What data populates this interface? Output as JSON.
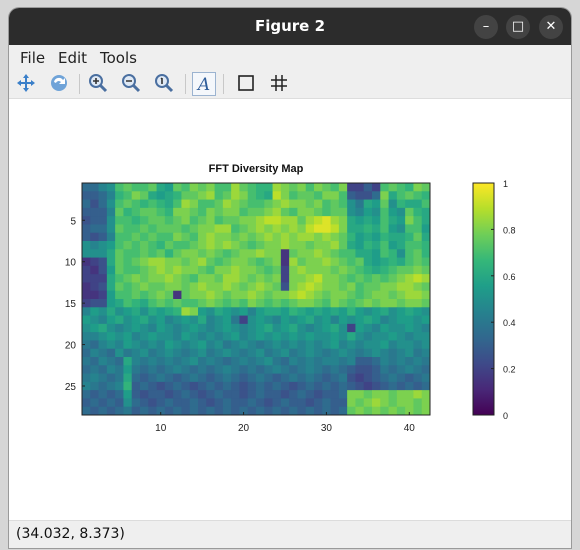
{
  "window": {
    "title": "Figure 2",
    "controls": [
      "minimize-icon",
      "maximize-icon",
      "close-icon"
    ]
  },
  "menu": {
    "items": [
      "File",
      "Edit",
      "Tools"
    ]
  },
  "toolbar": {
    "tools": [
      "pan-icon",
      "rotate-icon",
      "zoom-in-icon",
      "zoom-out-icon",
      "zoom-reset-icon",
      "text-annotation-icon",
      "axes-box-icon",
      "grid-icon"
    ],
    "text_glyph": "A"
  },
  "status": {
    "coords": "(34.032, 8.373)"
  },
  "colors": {
    "colormap": [
      "#440154",
      "#482878",
      "#3e4a89",
      "#31688e",
      "#26828e",
      "#1f9e89",
      "#35b779",
      "#6ece58",
      "#b5de2b",
      "#fde725"
    ]
  },
  "chart_data": {
    "type": "heatmap",
    "title": "FFT Diversity Map",
    "xlim": [
      0.5,
      42.5
    ],
    "ylim": [
      0.5,
      28.5
    ],
    "y_reversed": true,
    "x_ticks": [
      10,
      20,
      30,
      40
    ],
    "y_ticks": [
      5,
      10,
      15,
      20,
      25
    ],
    "colorbar": {
      "limits": [
        0,
        1
      ],
      "ticks": [
        "0",
        "0.2",
        "0.4",
        "0.6",
        "0.8",
        "1"
      ]
    },
    "colormap": "viridis",
    "n_cols": 42,
    "n_rows": 28,
    "values": [
      [
        0.35,
        0.35,
        0.45,
        0.5,
        0.7,
        0.75,
        0.7,
        0.7,
        0.75,
        0.6,
        0.55,
        0.75,
        0.7,
        0.8,
        0.75,
        0.8,
        0.7,
        0.7,
        0.85,
        0.75,
        0.7,
        0.65,
        0.65,
        0.85,
        0.8,
        0.75,
        0.8,
        0.7,
        0.8,
        0.75,
        0.7,
        0.8,
        0.2,
        0.2,
        0.3,
        0.2,
        0.7,
        0.75,
        0.7,
        0.65,
        0.8,
        0.75
      ],
      [
        0.3,
        0.3,
        0.35,
        0.45,
        0.65,
        0.7,
        0.8,
        0.75,
        0.6,
        0.55,
        0.6,
        0.65,
        0.75,
        0.75,
        0.8,
        0.85,
        0.7,
        0.75,
        0.85,
        0.8,
        0.7,
        0.65,
        0.6,
        0.9,
        0.8,
        0.7,
        0.75,
        0.75,
        0.7,
        0.8,
        0.8,
        0.7,
        0.3,
        0.25,
        0.25,
        0.35,
        0.8,
        0.6,
        0.7,
        0.75,
        0.7,
        0.65
      ],
      [
        0.35,
        0.25,
        0.35,
        0.5,
        0.7,
        0.75,
        0.7,
        0.65,
        0.7,
        0.65,
        0.6,
        0.7,
        0.85,
        0.8,
        0.7,
        0.7,
        0.75,
        0.85,
        0.8,
        0.75,
        0.7,
        0.7,
        0.75,
        0.8,
        0.85,
        0.8,
        0.8,
        0.75,
        0.8,
        0.7,
        0.75,
        0.7,
        0.5,
        0.4,
        0.6,
        0.55,
        0.75,
        0.5,
        0.65,
        0.6,
        0.6,
        0.7
      ],
      [
        0.3,
        0.3,
        0.3,
        0.45,
        0.75,
        0.65,
        0.7,
        0.75,
        0.75,
        0.7,
        0.65,
        0.8,
        0.8,
        0.75,
        0.7,
        0.8,
        0.75,
        0.8,
        0.8,
        0.7,
        0.75,
        0.75,
        0.8,
        0.85,
        0.75,
        0.7,
        0.8,
        0.8,
        0.75,
        0.7,
        0.75,
        0.75,
        0.5,
        0.45,
        0.55,
        0.5,
        0.7,
        0.55,
        0.5,
        0.75,
        0.65,
        0.6
      ],
      [
        0.25,
        0.3,
        0.3,
        0.5,
        0.7,
        0.7,
        0.65,
        0.7,
        0.75,
        0.75,
        0.7,
        0.75,
        0.8,
        0.7,
        0.75,
        0.8,
        0.7,
        0.75,
        0.75,
        0.8,
        0.8,
        0.85,
        0.9,
        0.9,
        0.85,
        0.85,
        0.75,
        0.85,
        0.9,
        0.95,
        0.85,
        0.8,
        0.6,
        0.55,
        0.6,
        0.55,
        0.7,
        0.6,
        0.55,
        0.8,
        0.7,
        0.6
      ],
      [
        0.3,
        0.35,
        0.35,
        0.5,
        0.75,
        0.7,
        0.7,
        0.75,
        0.7,
        0.75,
        0.75,
        0.75,
        0.7,
        0.75,
        0.8,
        0.8,
        0.85,
        0.85,
        0.7,
        0.75,
        0.8,
        0.85,
        0.8,
        0.85,
        0.8,
        0.85,
        0.8,
        0.9,
        0.95,
        0.95,
        0.9,
        0.8,
        0.6,
        0.6,
        0.65,
        0.6,
        0.7,
        0.55,
        0.5,
        0.7,
        0.7,
        0.55
      ],
      [
        0.3,
        0.25,
        0.3,
        0.45,
        0.7,
        0.7,
        0.75,
        0.7,
        0.75,
        0.7,
        0.7,
        0.8,
        0.75,
        0.7,
        0.8,
        0.85,
        0.8,
        0.8,
        0.75,
        0.8,
        0.75,
        0.8,
        0.85,
        0.8,
        0.85,
        0.8,
        0.85,
        0.85,
        0.8,
        0.85,
        0.8,
        0.75,
        0.65,
        0.55,
        0.6,
        0.55,
        0.65,
        0.6,
        0.6,
        0.65,
        0.75,
        0.6
      ],
      [
        0.5,
        0.45,
        0.5,
        0.55,
        0.7,
        0.75,
        0.7,
        0.75,
        0.7,
        0.65,
        0.75,
        0.7,
        0.7,
        0.75,
        0.8,
        0.85,
        0.8,
        0.85,
        0.8,
        0.75,
        0.7,
        0.75,
        0.8,
        0.8,
        0.85,
        0.8,
        0.8,
        0.75,
        0.8,
        0.8,
        0.85,
        0.75,
        0.6,
        0.55,
        0.65,
        0.6,
        0.7,
        0.55,
        0.6,
        0.7,
        0.7,
        0.65
      ],
      [
        0.5,
        0.5,
        0.5,
        0.6,
        0.75,
        0.7,
        0.7,
        0.75,
        0.7,
        0.75,
        0.65,
        0.75,
        0.8,
        0.8,
        0.75,
        0.8,
        0.75,
        0.7,
        0.75,
        0.8,
        0.8,
        0.85,
        0.8,
        0.8,
        0.15,
        0.75,
        0.8,
        0.8,
        0.85,
        0.8,
        0.75,
        0.7,
        0.7,
        0.6,
        0.6,
        0.55,
        0.7,
        0.65,
        0.5,
        0.7,
        0.75,
        0.65
      ],
      [
        0.15,
        0.2,
        0.25,
        0.6,
        0.75,
        0.7,
        0.75,
        0.8,
        0.85,
        0.85,
        0.8,
        0.8,
        0.75,
        0.8,
        0.85,
        0.75,
        0.7,
        0.75,
        0.8,
        0.8,
        0.75,
        0.7,
        0.75,
        0.8,
        0.15,
        0.85,
        0.75,
        0.8,
        0.8,
        0.85,
        0.8,
        0.75,
        0.7,
        0.75,
        0.6,
        0.55,
        0.6,
        0.65,
        0.6,
        0.7,
        0.75,
        0.7
      ],
      [
        0.2,
        0.15,
        0.25,
        0.55,
        0.75,
        0.7,
        0.7,
        0.75,
        0.8,
        0.85,
        0.8,
        0.85,
        0.8,
        0.8,
        0.75,
        0.7,
        0.8,
        0.8,
        0.85,
        0.8,
        0.8,
        0.75,
        0.7,
        0.75,
        0.2,
        0.8,
        0.85,
        0.8,
        0.8,
        0.8,
        0.75,
        0.8,
        0.75,
        0.7,
        0.65,
        0.6,
        0.65,
        0.7,
        0.75,
        0.75,
        0.8,
        0.75
      ],
      [
        0.2,
        0.2,
        0.2,
        0.6,
        0.7,
        0.75,
        0.8,
        0.75,
        0.8,
        0.8,
        0.85,
        0.8,
        0.75,
        0.7,
        0.8,
        0.8,
        0.75,
        0.85,
        0.85,
        0.8,
        0.75,
        0.8,
        0.75,
        0.8,
        0.2,
        0.8,
        0.8,
        0.85,
        0.9,
        0.8,
        0.8,
        0.75,
        0.7,
        0.75,
        0.7,
        0.75,
        0.7,
        0.75,
        0.8,
        0.85,
        0.9,
        0.85
      ],
      [
        0.15,
        0.2,
        0.25,
        0.6,
        0.75,
        0.7,
        0.75,
        0.8,
        0.75,
        0.75,
        0.8,
        0.8,
        0.75,
        0.8,
        0.85,
        0.8,
        0.8,
        0.85,
        0.8,
        0.75,
        0.8,
        0.85,
        0.8,
        0.75,
        0.25,
        0.8,
        0.85,
        0.9,
        0.85,
        0.8,
        0.8,
        0.75,
        0.8,
        0.7,
        0.75,
        0.75,
        0.8,
        0.8,
        0.85,
        0.85,
        0.8,
        0.75
      ],
      [
        0.15,
        0.15,
        0.2,
        0.55,
        0.7,
        0.7,
        0.75,
        0.7,
        0.75,
        0.8,
        0.75,
        0.15,
        0.75,
        0.8,
        0.8,
        0.85,
        0.8,
        0.75,
        0.8,
        0.8,
        0.85,
        0.8,
        0.75,
        0.8,
        0.8,
        0.85,
        0.9,
        0.85,
        0.8,
        0.75,
        0.8,
        0.8,
        0.75,
        0.7,
        0.75,
        0.8,
        0.8,
        0.75,
        0.8,
        0.85,
        0.85,
        0.8
      ],
      [
        0.2,
        0.25,
        0.25,
        0.55,
        0.6,
        0.7,
        0.65,
        0.6,
        0.7,
        0.75,
        0.7,
        0.75,
        0.7,
        0.7,
        0.75,
        0.8,
        0.75,
        0.7,
        0.75,
        0.7,
        0.8,
        0.75,
        0.7,
        0.75,
        0.7,
        0.75,
        0.8,
        0.8,
        0.75,
        0.7,
        0.8,
        0.75,
        0.7,
        0.75,
        0.8,
        0.75,
        0.8,
        0.8,
        0.75,
        0.8,
        0.8,
        0.75
      ],
      [
        0.45,
        0.55,
        0.5,
        0.6,
        0.5,
        0.55,
        0.6,
        0.5,
        0.6,
        0.55,
        0.6,
        0.65,
        0.85,
        0.8,
        0.55,
        0.5,
        0.6,
        0.55,
        0.5,
        0.55,
        0.45,
        0.55,
        0.6,
        0.6,
        0.55,
        0.65,
        0.6,
        0.55,
        0.6,
        0.55,
        0.6,
        0.55,
        0.65,
        0.55,
        0.5,
        0.55,
        0.6,
        0.5,
        0.55,
        0.6,
        0.55,
        0.5
      ],
      [
        0.55,
        0.5,
        0.45,
        0.55,
        0.6,
        0.5,
        0.55,
        0.6,
        0.5,
        0.55,
        0.45,
        0.5,
        0.55,
        0.5,
        0.6,
        0.45,
        0.5,
        0.55,
        0.4,
        0.2,
        0.5,
        0.55,
        0.5,
        0.45,
        0.55,
        0.5,
        0.55,
        0.6,
        0.5,
        0.55,
        0.45,
        0.55,
        0.5,
        0.55,
        0.6,
        0.55,
        0.45,
        0.5,
        0.55,
        0.55,
        0.5,
        0.55
      ],
      [
        0.5,
        0.55,
        0.6,
        0.5,
        0.45,
        0.5,
        0.55,
        0.5,
        0.45,
        0.55,
        0.5,
        0.45,
        0.5,
        0.55,
        0.5,
        0.45,
        0.5,
        0.55,
        0.5,
        0.45,
        0.5,
        0.55,
        0.6,
        0.5,
        0.55,
        0.6,
        0.5,
        0.45,
        0.5,
        0.55,
        0.6,
        0.5,
        0.2,
        0.55,
        0.5,
        0.45,
        0.55,
        0.5,
        0.5,
        0.55,
        0.5,
        0.45
      ],
      [
        0.45,
        0.45,
        0.5,
        0.55,
        0.5,
        0.55,
        0.45,
        0.5,
        0.55,
        0.5,
        0.5,
        0.45,
        0.55,
        0.5,
        0.45,
        0.5,
        0.45,
        0.5,
        0.55,
        0.45,
        0.5,
        0.55,
        0.5,
        0.55,
        0.5,
        0.55,
        0.5,
        0.55,
        0.5,
        0.5,
        0.55,
        0.5,
        0.6,
        0.5,
        0.45,
        0.5,
        0.5,
        0.55,
        0.5,
        0.45,
        0.5,
        0.5
      ],
      [
        0.4,
        0.35,
        0.45,
        0.5,
        0.45,
        0.55,
        0.5,
        0.45,
        0.5,
        0.45,
        0.55,
        0.5,
        0.45,
        0.5,
        0.55,
        0.45,
        0.5,
        0.4,
        0.45,
        0.5,
        0.45,
        0.4,
        0.45,
        0.5,
        0.45,
        0.5,
        0.45,
        0.5,
        0.45,
        0.5,
        0.55,
        0.45,
        0.5,
        0.45,
        0.5,
        0.5,
        0.55,
        0.45,
        0.5,
        0.5,
        0.45,
        0.5
      ],
      [
        0.35,
        0.45,
        0.4,
        0.35,
        0.5,
        0.4,
        0.45,
        0.5,
        0.4,
        0.45,
        0.5,
        0.45,
        0.4,
        0.45,
        0.5,
        0.4,
        0.45,
        0.5,
        0.45,
        0.4,
        0.45,
        0.5,
        0.4,
        0.45,
        0.5,
        0.4,
        0.45,
        0.5,
        0.45,
        0.4,
        0.45,
        0.5,
        0.45,
        0.4,
        0.45,
        0.5,
        0.45,
        0.4,
        0.45,
        0.5,
        0.4,
        0.45
      ],
      [
        0.4,
        0.35,
        0.45,
        0.4,
        0.35,
        0.6,
        0.45,
        0.4,
        0.45,
        0.4,
        0.45,
        0.4,
        0.45,
        0.5,
        0.4,
        0.45,
        0.4,
        0.35,
        0.4,
        0.45,
        0.4,
        0.45,
        0.5,
        0.4,
        0.35,
        0.45,
        0.4,
        0.45,
        0.4,
        0.45,
        0.45,
        0.4,
        0.45,
        0.3,
        0.3,
        0.35,
        0.45,
        0.4,
        0.45,
        0.4,
        0.45,
        0.4
      ],
      [
        0.35,
        0.4,
        0.35,
        0.45,
        0.4,
        0.55,
        0.4,
        0.35,
        0.4,
        0.35,
        0.4,
        0.45,
        0.4,
        0.35,
        0.4,
        0.35,
        0.4,
        0.45,
        0.4,
        0.35,
        0.4,
        0.35,
        0.4,
        0.45,
        0.4,
        0.35,
        0.4,
        0.45,
        0.4,
        0.35,
        0.4,
        0.35,
        0.3,
        0.25,
        0.25,
        0.3,
        0.4,
        0.35,
        0.4,
        0.45,
        0.4,
        0.35
      ],
      [
        0.4,
        0.45,
        0.4,
        0.35,
        0.4,
        0.6,
        0.35,
        0.3,
        0.35,
        0.4,
        0.35,
        0.3,
        0.35,
        0.4,
        0.35,
        0.3,
        0.35,
        0.4,
        0.35,
        0.3,
        0.35,
        0.4,
        0.35,
        0.3,
        0.35,
        0.4,
        0.35,
        0.4,
        0.35,
        0.3,
        0.35,
        0.4,
        0.25,
        0.2,
        0.25,
        0.3,
        0.35,
        0.4,
        0.35,
        0.3,
        0.35,
        0.4
      ],
      [
        0.45,
        0.4,
        0.35,
        0.4,
        0.45,
        0.65,
        0.3,
        0.35,
        0.3,
        0.25,
        0.3,
        0.35,
        0.3,
        0.25,
        0.3,
        0.35,
        0.3,
        0.35,
        0.3,
        0.25,
        0.3,
        0.35,
        0.3,
        0.35,
        0.3,
        0.25,
        0.3,
        0.35,
        0.3,
        0.35,
        0.3,
        0.35,
        0.3,
        0.25,
        0.2,
        0.25,
        0.3,
        0.35,
        0.3,
        0.35,
        0.3,
        0.35
      ],
      [
        0.35,
        0.3,
        0.35,
        0.3,
        0.35,
        0.55,
        0.3,
        0.25,
        0.3,
        0.3,
        0.25,
        0.3,
        0.35,
        0.3,
        0.25,
        0.3,
        0.35,
        0.3,
        0.3,
        0.25,
        0.3,
        0.35,
        0.3,
        0.3,
        0.25,
        0.3,
        0.35,
        0.3,
        0.25,
        0.3,
        0.3,
        0.35,
        0.8,
        0.8,
        0.75,
        0.8,
        0.8,
        0.75,
        0.8,
        0.8,
        0.85,
        0.8
      ],
      [
        0.3,
        0.35,
        0.3,
        0.35,
        0.3,
        0.5,
        0.35,
        0.3,
        0.25,
        0.3,
        0.35,
        0.3,
        0.3,
        0.35,
        0.3,
        0.25,
        0.3,
        0.35,
        0.3,
        0.3,
        0.35,
        0.3,
        0.25,
        0.3,
        0.35,
        0.3,
        0.3,
        0.25,
        0.3,
        0.35,
        0.3,
        0.3,
        0.8,
        0.75,
        0.8,
        0.85,
        0.8,
        0.75,
        0.8,
        0.8,
        0.75,
        0.8
      ],
      [
        0.35,
        0.3,
        0.35,
        0.3,
        0.35,
        0.4,
        0.3,
        0.35,
        0.3,
        0.35,
        0.3,
        0.35,
        0.3,
        0.35,
        0.3,
        0.35,
        0.3,
        0.35,
        0.3,
        0.35,
        0.3,
        0.35,
        0.3,
        0.35,
        0.3,
        0.35,
        0.3,
        0.35,
        0.3,
        0.35,
        0.3,
        0.35,
        0.75,
        0.8,
        0.75,
        0.8,
        0.75,
        0.8,
        0.75,
        0.8,
        0.75,
        0.8
      ]
    ]
  }
}
